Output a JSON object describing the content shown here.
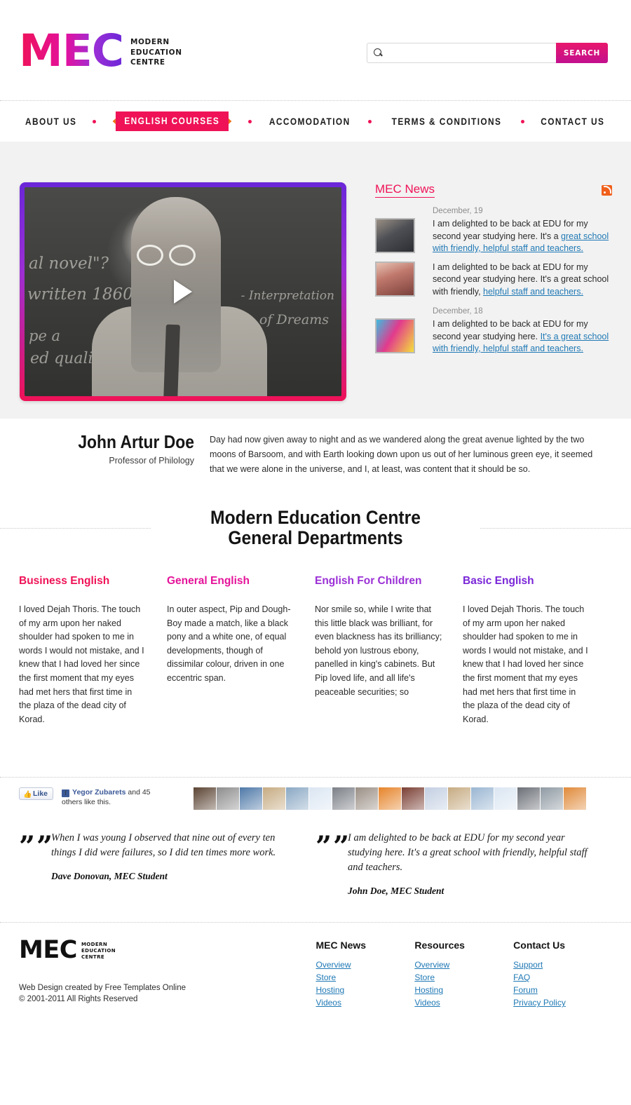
{
  "brand": {
    "logo_main": "MEC",
    "logo_sub_lines": [
      "Modern",
      "Education",
      "Centre"
    ],
    "gradient_start": "#ef1257",
    "gradient_end": "#6a26d8"
  },
  "search": {
    "placeholder": "",
    "value": "",
    "button_label": "SEARCH",
    "icon": "search-icon"
  },
  "nav": {
    "items": [
      {
        "label": "ABOUT US",
        "active": false
      },
      {
        "label": "ENGLISH COURSES",
        "active": true
      },
      {
        "label": "ACCOMODATION",
        "active": false
      },
      {
        "label": "TERMS & CONDITIONS",
        "active": false
      },
      {
        "label": "CONTACT US",
        "active": false
      }
    ],
    "active_color": "#ef1257"
  },
  "hero": {
    "video": {
      "play_icon": "play-icon",
      "chalk": {
        "l1": "al novel\"?",
        "l2": "written 1860",
        "l3": "pe a",
        "l4": "ed quality of",
        "r1": "- Interpretation",
        "r2": "of Dreams"
      }
    },
    "news": {
      "title": "MEC News",
      "rss_icon": "rss-icon",
      "groups": [
        {
          "date": "December, 19",
          "items": [
            {
              "text_plain": "I am delighted to be back at EDU for my second year studying here. It's a ",
              "text_link": "great school with friendly, helpful staff and teachers. ",
              "thumb": "students-thumb"
            },
            {
              "text_plain": "I am delighted to be back at EDU for my second year studying here. It's a great school with friendly, ",
              "text_link": "helpful staff and teachers. ",
              "thumb": "woman-thumb"
            }
          ]
        },
        {
          "date": "December, 18",
          "items": [
            {
              "text_plain": "I am delighted to be back at EDU for my second year studying here. ",
              "text_link": "It's a great school with friendly, helpful staff and teachers. ",
              "thumb": "group-thumb"
            }
          ]
        }
      ]
    },
    "bio": {
      "name": "John Artur Doe",
      "role": "Professor of Philology",
      "text": "Day had now given away to night and as we wandered along the great avenue lighted by the two moons of Barsoom, and with Earth looking down upon us out of her luminous green eye, it seemed that we were alone in the universe, and I, at least, was content that it should be so."
    }
  },
  "departments": {
    "heading": "Modern Education Centre General Departments",
    "columns": [
      {
        "title": "Business English",
        "color": "#ef1257",
        "text": "I loved Dejah Thoris. The touch of my arm upon her naked shoulder had spoken to me in words I would not mistake, and I knew that I had loved her since the first moment that my eyes had met hers that first time in the plaza of the dead city of Korad."
      },
      {
        "title": "General English",
        "color": "#e5139a",
        "text": "In outer aspect, Pip and Dough-Boy made a match, like a black pony and a white one, of equal developments, though of dissimilar colour, driven in one eccentric span."
      },
      {
        "title": "English For Children",
        "color": "#9b2fd6",
        "text": "Nor smile so, while I write that this little black was brilliant, for even blackness has its brilliancy; behold yon lustrous ebony, panelled in king's cabinets. But Pip loved life, and all life's peaceable securities; so"
      },
      {
        "title": "Basic English",
        "color": "#7a26d8",
        "text": "I loved Dejah Thoris. The touch of my arm upon her naked shoulder had spoken to me in words I would not mistake, and I knew that I had loved her since the first moment that my eyes had met hers that first time in the plaza of the dead city of Korad."
      }
    ]
  },
  "social": {
    "like_button_label": "Like",
    "like_icon": "thumbs-up-icon",
    "facebook_icon": "facebook-icon",
    "liker_name": "Yegor Zubarets",
    "liker_suffix": " and 45 others like this.",
    "avatar_count": 17,
    "avatar_colors": [
      "#5b4433",
      "#8d8d8d",
      "#4f79a8",
      "#c6ab82",
      "#8aa8c4",
      "#dbe6f2",
      "#7b7f86",
      "#9a8f85",
      "#e6842a",
      "#7a3f34",
      "#c3cfe2",
      "#c6ab82",
      "#9ab6d2",
      "#dbe6f2",
      "#6b6f76",
      "#8f9aa3",
      "#e08a3a"
    ]
  },
  "testimonials": [
    {
      "quote_mark": "””",
      "text": "When I was young I observed that nine out of every ten things I did were failures, so I did ten times more work.",
      "author": "Dave Donovan, MEC Student"
    },
    {
      "quote_mark": "””",
      "text": "I am delighted to be back at EDU for my second year studying here. It's a great school with friendly, helpful staff and teachers.",
      "author": "John Doe, MEC Student"
    }
  ],
  "footer": {
    "logo_main": "MEC",
    "logo_sub_lines": [
      "Modern",
      "Education",
      "Centre"
    ],
    "credit": "Web Design created by Free Templates Online",
    "copyright": "© 2001-2011 All Rights Reserved",
    "columns": [
      {
        "title": "MEC News",
        "links": [
          "Overview",
          "Store",
          "Hosting",
          "Videos"
        ]
      },
      {
        "title": "Resources",
        "links": [
          "Overview",
          "Store",
          "Hosting",
          "Videos"
        ]
      },
      {
        "title": "Contact Us",
        "links": [
          "Support",
          "FAQ",
          "Forum",
          "Privacy Policy"
        ]
      }
    ]
  }
}
